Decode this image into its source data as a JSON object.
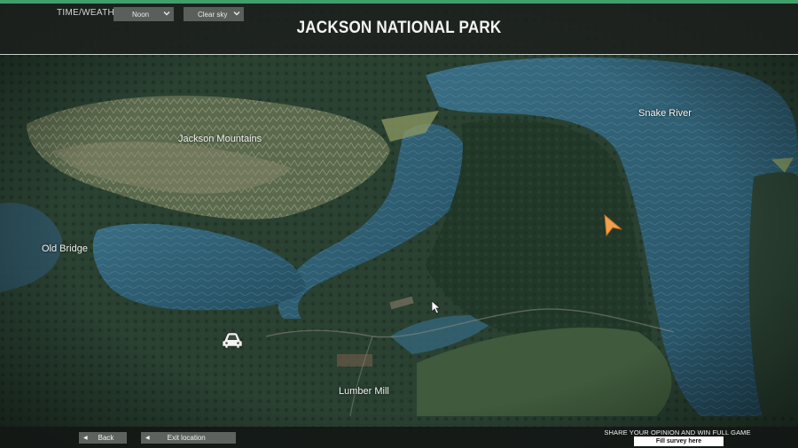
{
  "header": {
    "time_weather_label": "TIME/WEATHER",
    "time_value": "Noon",
    "weather_value": "Clear sky",
    "title": "JACKSON NATIONAL PARK"
  },
  "map": {
    "labels": {
      "jackson_mountains": "Jackson Mountains",
      "snake_river": "Snake River",
      "old_bridge": "Old Bridge",
      "lumber_mill": "Lumber Mill"
    },
    "icons": [
      "car-icon",
      "player-arrow-icon",
      "mouse-cursor-icon"
    ]
  },
  "footer": {
    "back_label": "Back",
    "exit_label": "Exit location",
    "survey_text": "SHARE YOUR OPINION AND WIN FULL GAME",
    "survey_button": "Fill survey here"
  },
  "colors": {
    "accent": "#3fa06a",
    "player_arrow": "#f0a050",
    "water": "#2d5d73",
    "forest": "#243b2c"
  }
}
